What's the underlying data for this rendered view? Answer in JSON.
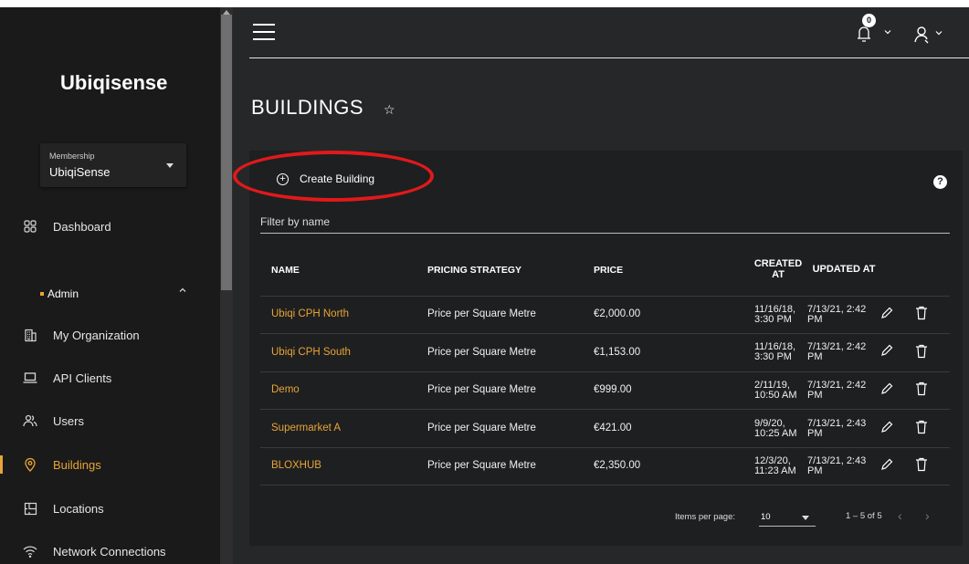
{
  "sidebar": {
    "brand": "Ubiqisense",
    "membership": {
      "label": "Membership",
      "value": "UbiqiSense"
    },
    "items": [
      {
        "label": "Dashboard",
        "icon": "grid-icon"
      },
      {
        "label": "Admin",
        "icon": "dot-icon"
      },
      {
        "label": "My Organization",
        "icon": "building-icon"
      },
      {
        "label": "API Clients",
        "icon": "laptop-icon"
      },
      {
        "label": "Users",
        "icon": "users-icon"
      },
      {
        "label": "Buildings",
        "icon": "location-pin-icon",
        "active": true
      },
      {
        "label": "Locations",
        "icon": "floorplan-icon"
      },
      {
        "label": "Network Connections",
        "icon": "wifi-icon"
      }
    ]
  },
  "header": {
    "notification_count": "0"
  },
  "page": {
    "title": "BUILDINGS"
  },
  "toolbar": {
    "create_label": "Create Building",
    "help": "?"
  },
  "filter": {
    "placeholder": "Filter by name"
  },
  "table": {
    "columns": [
      "NAME",
      "PRICING STRATEGY",
      "PRICE",
      "CREATED AT",
      "UPDATED AT"
    ],
    "rows": [
      {
        "name": "Ubiqi CPH North",
        "strategy": "Price per Square Metre",
        "price": "€2,000.00",
        "created": "11/16/18, 3:30 PM",
        "updated": "7/13/21, 2:42 PM"
      },
      {
        "name": "Ubiqi CPH South",
        "strategy": "Price per Square Metre",
        "price": "€1,153.00",
        "created": "11/16/18, 3:30 PM",
        "updated": "7/13/21, 2:42 PM"
      },
      {
        "name": "Demo",
        "strategy": "Price per Square Metre",
        "price": "€999.00",
        "created": "2/11/19, 10:50 AM",
        "updated": "7/13/21, 2:42 PM"
      },
      {
        "name": "Supermarket A",
        "strategy": "Price per Square Metre",
        "price": "€421.00",
        "created": "9/9/20, 10:25 AM",
        "updated": "7/13/21, 2:43 PM"
      },
      {
        "name": "BLOXHUB",
        "strategy": "Price per Square Metre",
        "price": "€2,350.00",
        "created": "12/3/20, 11:23 AM",
        "updated": "7/13/21, 2:43 PM"
      }
    ]
  },
  "paginator": {
    "items_per_page_label": "Items per page:",
    "items_per_page": "10",
    "range": "1 – 5 of 5"
  },
  "colors": {
    "accent": "#e8a437",
    "annotation": "#e0191b",
    "sidebar_bg": "#1a1a1a",
    "main_bg": "#262728",
    "card_bg": "#1e1f20"
  }
}
